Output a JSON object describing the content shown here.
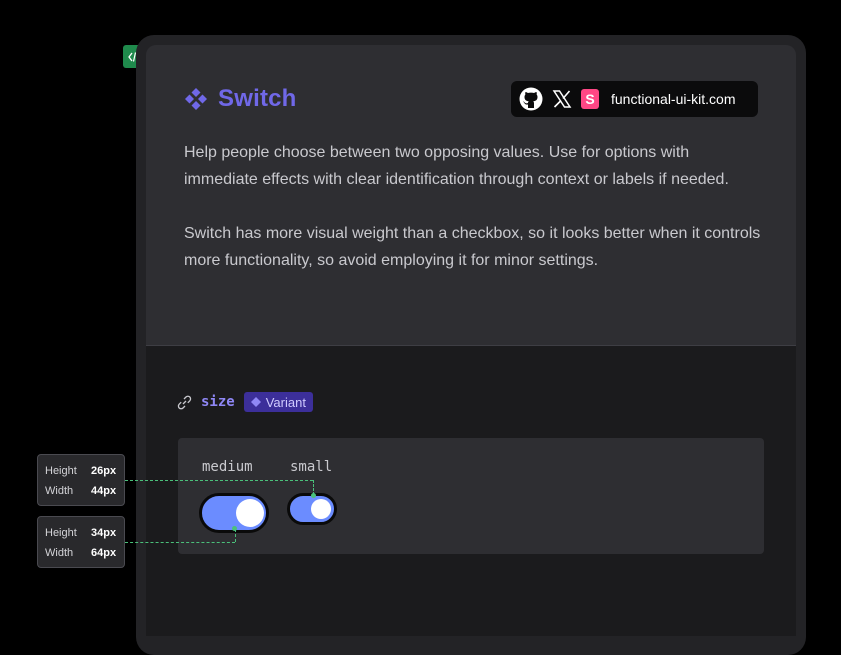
{
  "header": {
    "title": "Switch",
    "site_link": "functional-ui-kit.com",
    "icons": [
      "github-icon",
      "x-twitter-icon",
      "storybook-icon"
    ]
  },
  "description": {
    "paragraph1": "Help people choose between two opposing values. Use for options with immediate effects with clear identification through context or labels if needed.",
    "paragraph2": "Switch has more visual weight than a checkbox, so it looks better when it controls more functionality, so avoid employing it for minor settings."
  },
  "property": {
    "name": "size",
    "badge": "Variant"
  },
  "demo": {
    "medium_label": "medium",
    "small_label": "small",
    "medium_checked": true,
    "small_checked": true
  },
  "measurements": {
    "small": {
      "height_label": "Height",
      "height_value": "26px",
      "width_label": "Width",
      "width_value": "44px"
    },
    "medium": {
      "height_label": "Height",
      "height_value": "34px",
      "width_label": "Width",
      "width_value": "64px"
    }
  },
  "colors": {
    "accent": "#7068e8",
    "switch_on": "#6b8cff",
    "measure_line": "#4ac07a",
    "code_badge": "#1f8a4c"
  }
}
